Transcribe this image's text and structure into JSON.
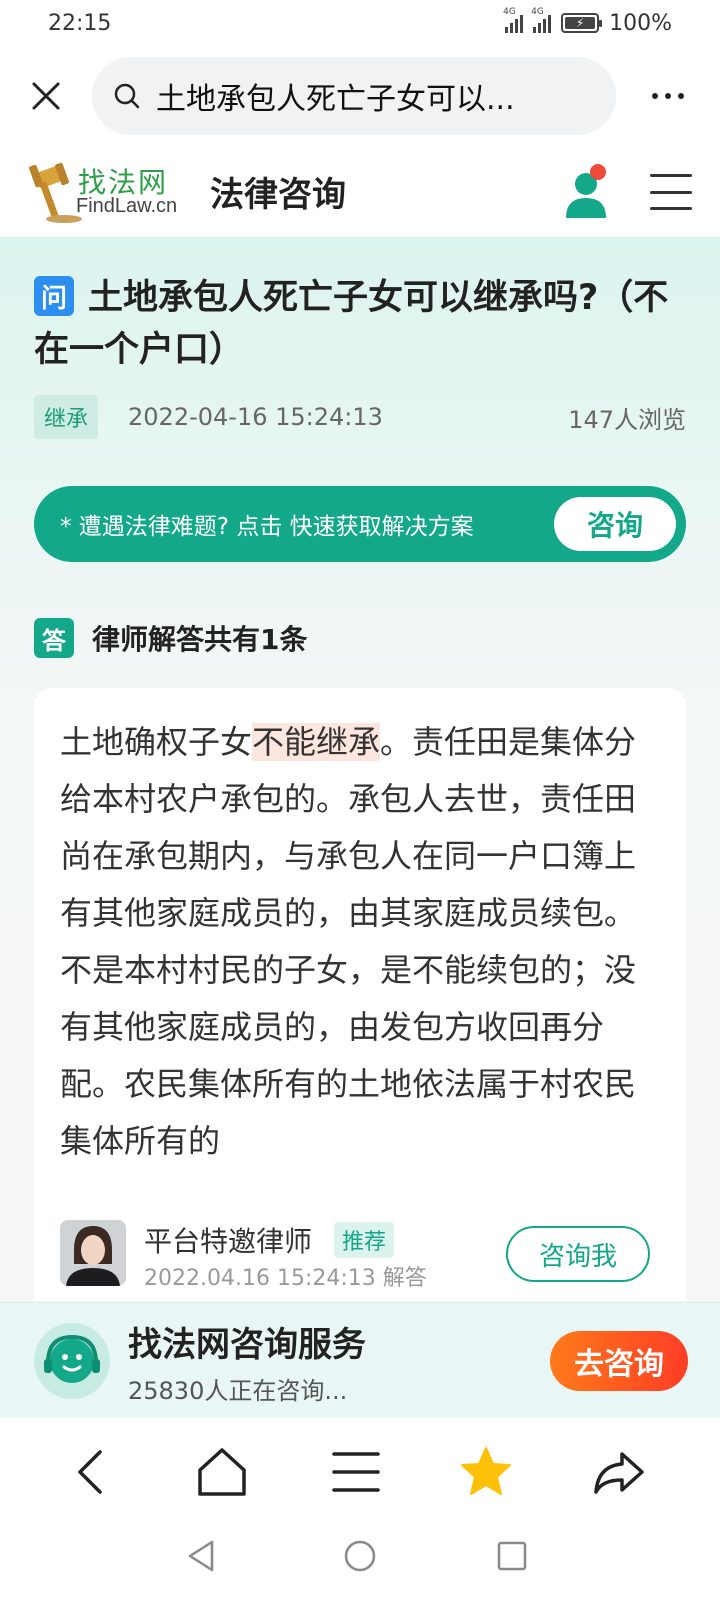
{
  "status_bar": {
    "time": "22:15",
    "network1": "4G",
    "network2": "4G",
    "battery": "100%"
  },
  "browser": {
    "url_text": "土地承包人死亡子女可以...",
    "close_icon": "close-icon",
    "search_icon": "search-icon",
    "more_icon": "more-icon"
  },
  "site": {
    "logo_cn": "找法网",
    "logo_en": "FindLaw.cn",
    "title": "法律咨询",
    "user_icon": "user-icon",
    "menu_icon": "menu-icon"
  },
  "question": {
    "badge": "问",
    "title": "土地承包人死亡子女可以继承吗?（不在一个户口）",
    "tag": "继承",
    "datetime": "2022-04-16 15:24:13",
    "views": "147人浏览"
  },
  "consult_banner": {
    "text": "* 遭遇法律难题? 点击 快速获取解决方案",
    "button": "咨询"
  },
  "answers": {
    "badge": "答",
    "heading": "律师解答共有1条",
    "items": [
      {
        "text_before": "土地确权子女",
        "highlight": "不能继承",
        "text_after": "。责任田是集体分给本村农户承包的。承包人去世，责任田尚在承包期内，与承包人在同一户口簿上有其他家庭成员的，由其家庭成员续包。不是本村村民的子女，是不能续包的；没有其他家庭成员的，由发包方收回再分配。农民集体所有的土地依法属于村农民集体所有的",
        "lawyer_name": "平台特邀律师",
        "lawyer_tag": "推荐",
        "answer_time": "2022.04.16 15:24:13 解答",
        "consult_button": "咨询我"
      }
    ]
  },
  "service_bar": {
    "title": "找法网咨询服务",
    "subtitle": "25830人正在咨询...",
    "button": "去咨询"
  },
  "colors": {
    "brand_green": "#13a889",
    "question_blue": "#2b8ef0",
    "cta_orange": "#ff5a20",
    "star_yellow": "#ffc107"
  }
}
